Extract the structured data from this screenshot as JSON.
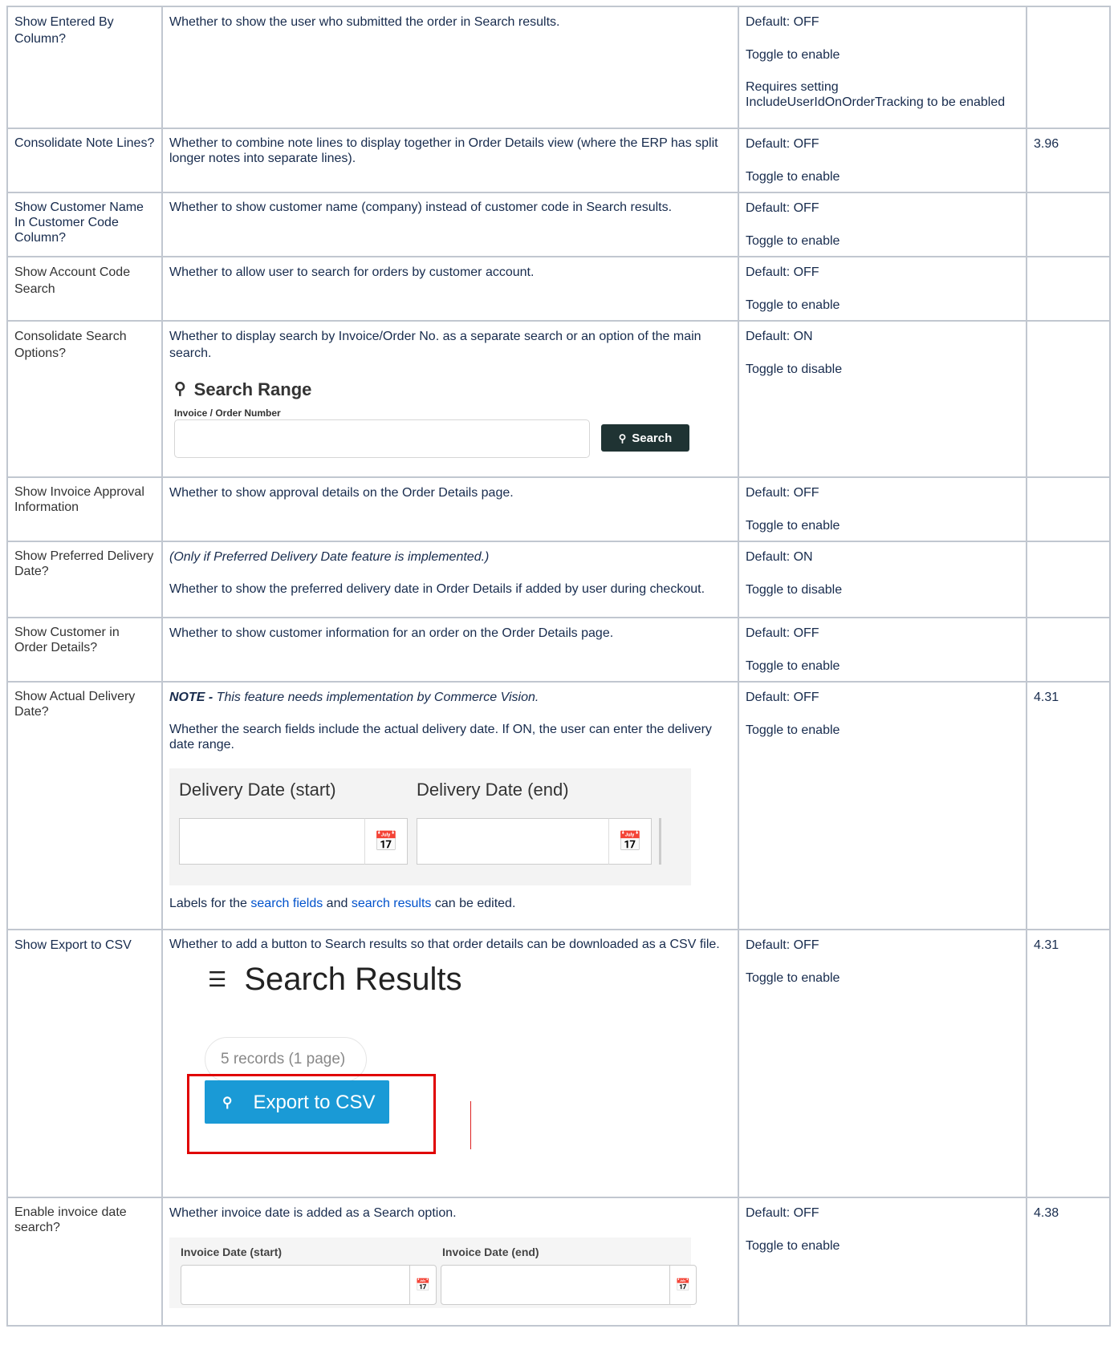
{
  "rows": [
    {
      "name": "Show Entered By Column?",
      "desc": "Whether to show the user who submitted the order in Search results.",
      "default": "Default: OFF",
      "toggle": "Toggle to enable",
      "extra": "Requires setting IncludeUserIdOnOrderTracking to be enabled",
      "version": ""
    },
    {
      "name": "Consolidate Note Lines?",
      "desc": "Whether to combine note lines to display together in Order Details view (where the ERP has split longer notes into separate lines).",
      "default": "Default: OFF",
      "toggle": "Toggle to enable",
      "version": "3.96"
    },
    {
      "name": "Show Customer Name In Customer Code Column?",
      "desc": "Whether to show customer name (company) instead of customer code in Search results.",
      "default": "Default: OFF",
      "toggle": "Toggle to enable",
      "version": ""
    },
    {
      "name": "Show Account Code Search",
      "desc": "Whether to allow user to search for orders by customer account.",
      "default": "Default: OFF",
      "toggle": "Toggle to enable",
      "version": ""
    },
    {
      "name": "Consolidate Search Options?",
      "desc": "Whether to display search by Invoice/Order No. as a separate search or an option of the main search.",
      "default": "Default: ON",
      "toggle": "Toggle to disable",
      "version": ""
    },
    {
      "name": "Show Invoice Approval Information",
      "desc": "Whether to show approval details on the Order Details page.",
      "default": "Default: OFF",
      "toggle": "Toggle to enable",
      "version": ""
    },
    {
      "name": "Show Preferred Delivery Date?",
      "note": "(Only if Preferred Delivery Date feature is implemented.)",
      "desc": "Whether to show the preferred delivery date in Order Details if added by user during checkout.",
      "default": "Default: ON",
      "toggle": "Toggle to disable",
      "version": ""
    },
    {
      "name": "Show Customer in Order Details?",
      "desc": "Whether to show customer information for an order on the Order Details page.",
      "default": "Default: OFF",
      "toggle": "Toggle to enable",
      "version": ""
    },
    {
      "name": "Show Actual Delivery Date?",
      "note_bold": "NOTE -",
      "note": " This feature needs implementation by Commerce Vision.",
      "desc": "Whether the search fields include the actual delivery date. If ON, the user can enter the delivery date range.",
      "labels_pre": "Labels for the ",
      "link1": "search fields",
      "labels_mid": " and ",
      "link2": "search results",
      "labels_post": " can be edited.",
      "default": "Default: OFF",
      "toggle": "Toggle to enable",
      "version": "4.31"
    },
    {
      "name": "Show Export to CSV",
      "desc": "Whether to add a button to Search results so that order details can be downloaded as a CSV file.",
      "default": "Default: OFF",
      "toggle": "Toggle to enable",
      "version": "4.31"
    },
    {
      "name": "Enable invoice date search?",
      "desc": "Whether invoice date is added as a Search option.",
      "default": "Default: OFF",
      "toggle": "Toggle to enable",
      "version": "4.38"
    }
  ],
  "search_widget": {
    "title": "Search Range",
    "subtitle": "Invoice / Order Number",
    "button": "Search",
    "icon": "search-icon"
  },
  "delivery_widget": {
    "start": "Delivery Date (start)",
    "end": "Delivery Date (end)",
    "icon": "calendar-icon"
  },
  "csv_widget": {
    "title": "Search Results",
    "records": "5 records (1 page)",
    "button": "Export to CSV",
    "highlight_color": "#e00000",
    "button_color": "#1a9ad6"
  },
  "invoice_widget": {
    "start": "Invoice Date (start)",
    "end": "Invoice Date (end)"
  },
  "colors": {
    "border": "#c1c7d0",
    "link": "#0052cc"
  }
}
